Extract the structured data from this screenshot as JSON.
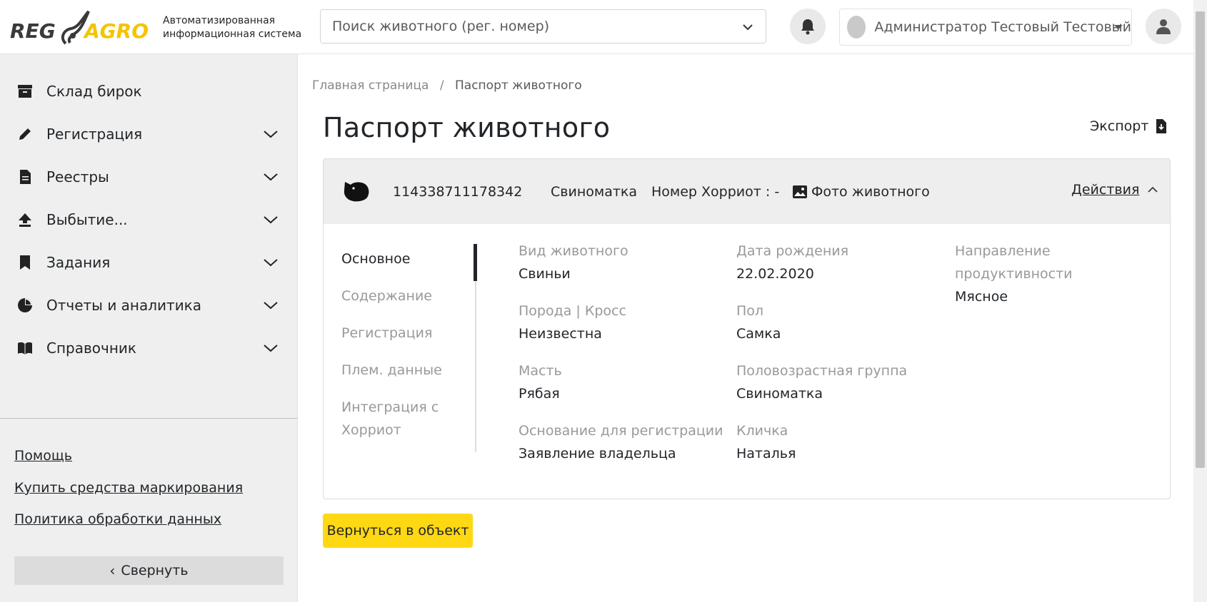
{
  "header": {
    "logo": {
      "left": "REG",
      "right": "AGRO"
    },
    "logo_subtitle_line1": "Автоматизированная",
    "logo_subtitle_line2": "информационная система",
    "search_placeholder": "Поиск животного (рег. номер)",
    "user_name": "Администратор Тестовый Тестовый"
  },
  "sidebar": {
    "items": [
      {
        "label": "Склад бирок",
        "icon": "archive-icon",
        "expandable": false
      },
      {
        "label": "Регистрация",
        "icon": "pencil-icon",
        "expandable": true
      },
      {
        "label": "Реестры",
        "icon": "document-icon",
        "expandable": true
      },
      {
        "label": "Выбытие...",
        "icon": "upload-arrow-icon",
        "expandable": true
      },
      {
        "label": "Задания",
        "icon": "bookmark-icon",
        "expandable": true
      },
      {
        "label": "Отчеты и аналитика",
        "icon": "pie-chart-icon",
        "expandable": true
      },
      {
        "label": "Справочник",
        "icon": "book-icon",
        "expandable": true
      }
    ],
    "links": [
      "Помощь",
      "Купить средства маркирования",
      "Политика обработки данных"
    ],
    "collapse_label": "Свернуть"
  },
  "breadcrumb": {
    "home": "Главная страница",
    "separator": "/",
    "current": "Паспорт животного"
  },
  "page": {
    "title": "Паспорт животного",
    "export_label": "Экспорт"
  },
  "animal": {
    "reg_number": "114338711178342",
    "type": "Свиноматка",
    "horriot_number": "Номер Хорриот : -",
    "photo_label": "Фото животного",
    "actions_label": "Действия"
  },
  "tabs": [
    "Основное",
    "Содержание",
    "Регистрация",
    "Плем. данные",
    "Интеграция с Хорриот"
  ],
  "active_tab": "Основное",
  "fields": {
    "species": {
      "label": "Вид животного",
      "value": "Свиньи"
    },
    "breed": {
      "label": "Порода | Кросс",
      "value": "Неизвестна"
    },
    "color": {
      "label": "Масть",
      "value": "Рябая"
    },
    "reg_basis": {
      "label": "Основание для регистрации",
      "value": "Заявление владельца"
    },
    "birth_date": {
      "label": "Дата рождения",
      "value": "22.02.2020"
    },
    "sex": {
      "label": "Пол",
      "value": "Самка"
    },
    "sex_age_group": {
      "label": "Половозрастная группа",
      "value": "Свиноматка"
    },
    "nickname": {
      "label": "Кличка",
      "value": "Наталья"
    },
    "productivity": {
      "label": "Направление продуктивности",
      "value": "Мясное"
    }
  },
  "back_button": "Вернуться в объект",
  "colors": {
    "accent_yellow": "#ffd814",
    "logo_yellow": "#f5c400",
    "sidebar_bg": "#efefef"
  }
}
